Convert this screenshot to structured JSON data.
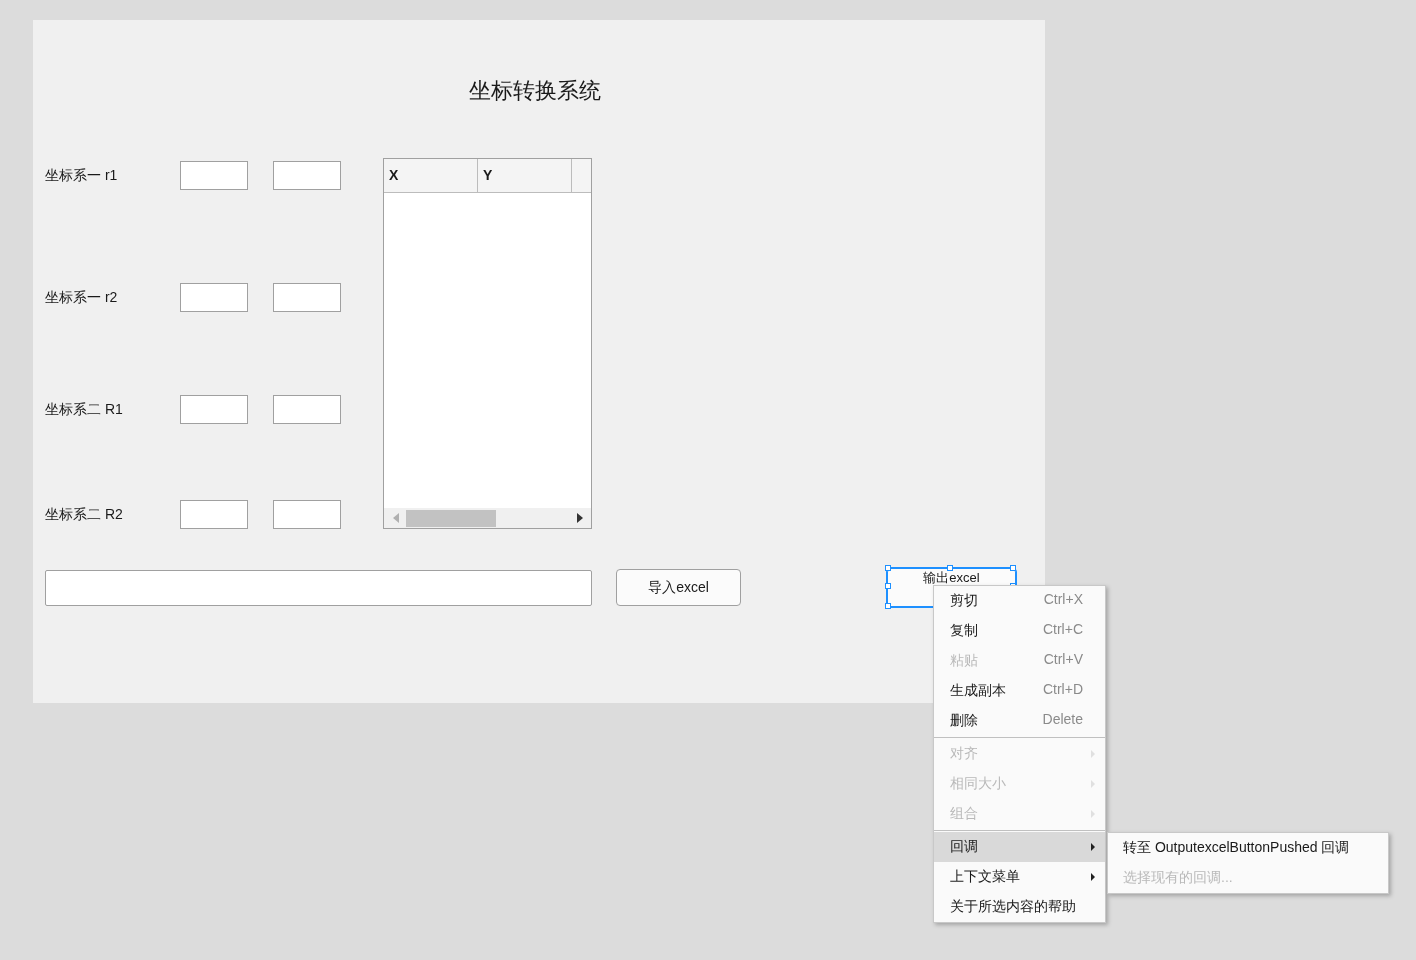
{
  "window": {
    "title": "坐标转换系统"
  },
  "coordinate_rows": [
    {
      "label": "坐标系一 r1"
    },
    {
      "label": "坐标系一 r2"
    },
    {
      "label": "坐标系二 R1"
    },
    {
      "label": "坐标系二 R2"
    }
  ],
  "table": {
    "columns": [
      "X",
      "Y"
    ]
  },
  "buttons": [
    {
      "label": "导入excel",
      "selected": false
    },
    {
      "label": "输出excel",
      "selected": true
    }
  ],
  "context_menu": {
    "items": [
      {
        "kind": "item",
        "label": "剪切",
        "shortcut": "Ctrl+X",
        "disabled": false,
        "selected": false
      },
      {
        "kind": "item",
        "label": "复制",
        "shortcut": "Ctrl+C",
        "disabled": false,
        "selected": false
      },
      {
        "kind": "item",
        "label": "粘贴",
        "shortcut": "Ctrl+V",
        "disabled": true,
        "selected": false
      },
      {
        "kind": "item",
        "label": "生成副本",
        "shortcut": "Ctrl+D",
        "disabled": false,
        "selected": false
      },
      {
        "kind": "item",
        "label": "删除",
        "shortcut": "Delete",
        "disabled": false,
        "selected": false
      },
      {
        "kind": "separator"
      },
      {
        "kind": "submenu",
        "label": "对齐",
        "disabled": true,
        "selected": false
      },
      {
        "kind": "submenu",
        "label": "相同大小",
        "disabled": true,
        "selected": false
      },
      {
        "kind": "submenu",
        "label": "组合",
        "disabled": true,
        "selected": false
      },
      {
        "kind": "separator"
      },
      {
        "kind": "submenu",
        "label": "回调",
        "disabled": false,
        "selected": true
      },
      {
        "kind": "submenu",
        "label": "上下文菜单",
        "disabled": false,
        "selected": false
      },
      {
        "kind": "item",
        "label": "关于所选内容的帮助",
        "disabled": false,
        "selected": false
      }
    ],
    "submenu": [
      {
        "label": "转至 OutputexcelButtonPushed 回调",
        "disabled": false
      },
      {
        "label": "选择现有的回调...",
        "disabled": true
      }
    ]
  }
}
